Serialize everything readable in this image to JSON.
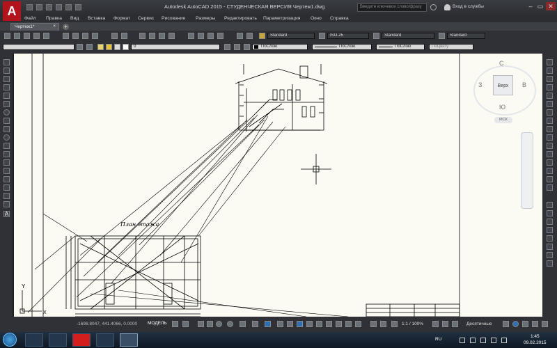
{
  "window": {
    "title": "Autodesk AutoCAD 2015 - СТУДЕНЧЕСКАЯ ВЕРСИЯ    Чертеж1.dwg",
    "logo": "A",
    "search_placeholder": "Введите ключевое слово/фразу",
    "signin": "Вход в службы",
    "minimize": "–",
    "restore": "▭",
    "close": "✕"
  },
  "menu": [
    "Файл",
    "Правка",
    "Вид",
    "Вставка",
    "Формат",
    "Сервис",
    "Рисование",
    "Размеры",
    "Редактировать",
    "Параметризация",
    "Окно",
    "Справка"
  ],
  "tabs": {
    "active": "Чертеж1*",
    "close": "×",
    "add": "+"
  },
  "styles": {
    "text": "Standard",
    "dim": "ISO-25",
    "table": "Standard",
    "mleader": "Standard"
  },
  "layers": {
    "current": "0",
    "color": "ПоСлою",
    "linetype": "ПоСлою",
    "lineweight": "ПоСлою",
    "plotstyle": "ПоЦвету"
  },
  "viewcube": {
    "n": "С",
    "s": "Ю",
    "w": "З",
    "e": "В",
    "face": "Верх",
    "wcs": "МСК"
  },
  "drawing": {
    "plan_label": "План этажа",
    "axis_y": "Y",
    "axis_x": "X"
  },
  "status": {
    "coords": "-1698.8047, 441.4066, 0.0000",
    "model": "МОДЕЛЬ",
    "scale": "1:1 / 100%",
    "units": "Десятичные"
  },
  "taskbar": {
    "lang": "RU",
    "time": "1:45",
    "date": "09.02.2015"
  },
  "colors": {
    "canvas": "#fbfaf3",
    "brand": "#b3141b",
    "linework": "#000000"
  }
}
